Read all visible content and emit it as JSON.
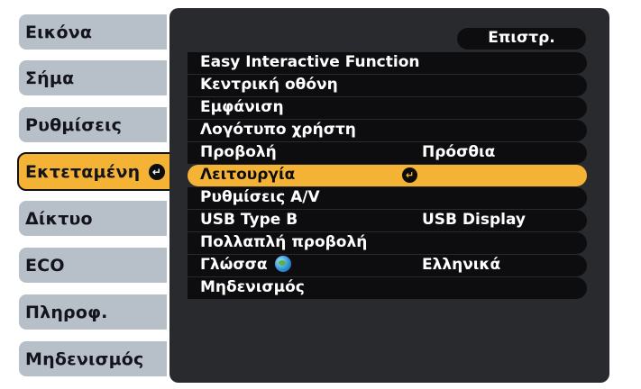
{
  "left_menu": {
    "items": [
      {
        "label": "Εικόνα"
      },
      {
        "label": "Σήμα"
      },
      {
        "label": "Ρυθμίσεις"
      },
      {
        "label": "Εκτεταμένη",
        "active": true
      },
      {
        "label": "Δίκτυο"
      },
      {
        "label": "ECO"
      },
      {
        "label": "Πληροφ."
      },
      {
        "label": "Μηδενισμός"
      }
    ]
  },
  "panel": {
    "back_label": "Επιστρ.",
    "rows": [
      {
        "label": "Easy Interactive Function",
        "value": ""
      },
      {
        "label": "Κεντρική οθόνη",
        "value": ""
      },
      {
        "label": "Εμφάνιση",
        "value": ""
      },
      {
        "label": "Λογότυπο χρήστη",
        "value": ""
      },
      {
        "label": "Προβολή",
        "value": "Πρόσθια"
      },
      {
        "label": "Λειτουργία",
        "value": "",
        "selected": true
      },
      {
        "label": "Ρυθμίσεις A/V",
        "value": ""
      },
      {
        "label": "USB Type B",
        "value": "USB Display"
      },
      {
        "label": "Πολλαπλή προβολή",
        "value": ""
      },
      {
        "label": "Γλώσσα",
        "value": "Ελληνικά",
        "icon": "globe-icon"
      },
      {
        "label": "Μηδενισμός",
        "value": ""
      }
    ]
  },
  "colors": {
    "highlight": "#f5b335",
    "panel_bg": "#292a2e",
    "row_bg": "#0d0d0f",
    "tab_bg": "#b7bfc9"
  }
}
